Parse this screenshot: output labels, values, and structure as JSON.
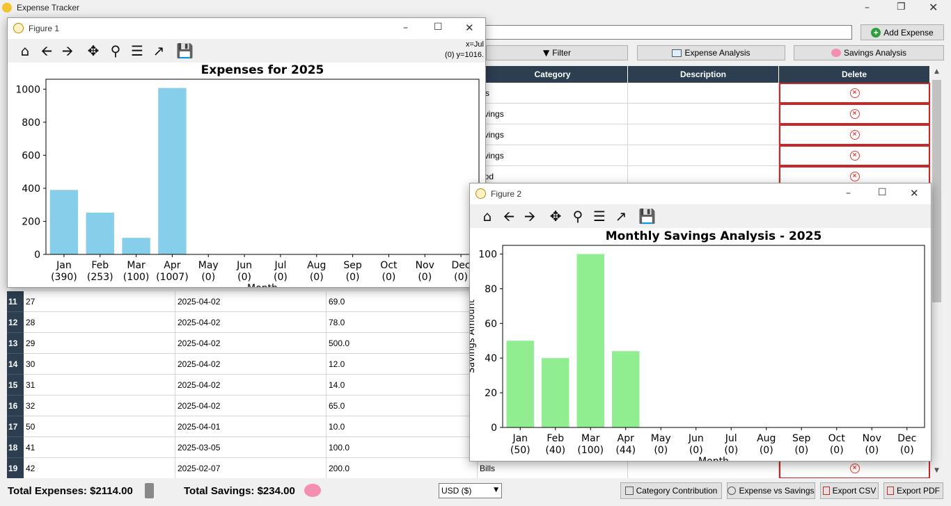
{
  "app": {
    "title": "Expense Tracker"
  },
  "toolbar": {
    "add_expense_label": "Add Expense",
    "filter_label": "Filter",
    "expense_analysis_label": "Expense Analysis",
    "savings_analysis_label": "Savings Analysis",
    "search_value": ""
  },
  "table": {
    "headers": {
      "category": "Category",
      "description": "Description",
      "delete": "Delete"
    },
    "top_rows_category": [
      "ills",
      "avings",
      "avings",
      "avings",
      "ood"
    ],
    "rows": [
      {
        "n": "11",
        "id": "27",
        "date": "2025-04-02",
        "amount": "69.0",
        "category": ""
      },
      {
        "n": "12",
        "id": "28",
        "date": "2025-04-02",
        "amount": "78.0",
        "category": ""
      },
      {
        "n": "13",
        "id": "29",
        "date": "2025-04-02",
        "amount": "500.0",
        "category": ""
      },
      {
        "n": "14",
        "id": "30",
        "date": "2025-04-02",
        "amount": "12.0",
        "category": ""
      },
      {
        "n": "15",
        "id": "31",
        "date": "2025-04-02",
        "amount": "14.0",
        "category": ""
      },
      {
        "n": "16",
        "id": "32",
        "date": "2025-04-02",
        "amount": "65.0",
        "category": ""
      },
      {
        "n": "17",
        "id": "50",
        "date": "2025-04-01",
        "amount": "10.0",
        "category": ""
      },
      {
        "n": "18",
        "id": "41",
        "date": "2025-03-05",
        "amount": "100.0",
        "category": ""
      },
      {
        "n": "19",
        "id": "42",
        "date": "2025-02-07",
        "amount": "200.0",
        "category": "Bills"
      }
    ]
  },
  "bottom": {
    "total_expenses": "Total Expenses: $2114.00",
    "total_savings": "Total Savings: $234.00",
    "currency": "USD ($)",
    "category_contribution": "Category Contribution",
    "expense_vs_savings": "Expense vs Savings",
    "export_csv": "Export CSV",
    "export_pdf": "Export PDF"
  },
  "figure1": {
    "window_title": "Figure 1",
    "coords_line1": "x=Jul",
    "coords_line2": "(0) y=1016.",
    "partial_xlabel": "Month"
  },
  "figure2": {
    "window_title": "Figure 2",
    "partial_xlabel": "Month",
    "partial_ylabel": "Savings Amount"
  },
  "chart_data": [
    {
      "type": "bar",
      "title": "Expenses for 2025",
      "categories": [
        "Jan\n(390)",
        "Feb\n(253)",
        "Mar\n(100)",
        "Apr\n(1007)",
        "May\n(0)",
        "Jun\n(0)",
        "Jul\n(0)",
        "Aug\n(0)",
        "Sep\n(0)",
        "Oct\n(0)",
        "Nov\n(0)",
        "Dec\n(0)"
      ],
      "values": [
        390,
        253,
        100,
        1007,
        0,
        0,
        0,
        0,
        0,
        0,
        0,
        0
      ],
      "xlabel": "Month",
      "ylim": [
        0,
        1060
      ],
      "yticks": [
        0,
        200,
        400,
        600,
        800,
        1000
      ],
      "color": "#87ceeb",
      "grid": false
    },
    {
      "type": "bar",
      "title": "Monthly Savings Analysis - 2025",
      "categories": [
        "Jan\n(50)",
        "Feb\n(40)",
        "Mar\n(100)",
        "Apr\n(44)",
        "May\n(0)",
        "Jun\n(0)",
        "Jul\n(0)",
        "Aug\n(0)",
        "Sep\n(0)",
        "Oct\n(0)",
        "Nov\n(0)",
        "Dec\n(0)"
      ],
      "values": [
        50,
        40,
        100,
        44,
        0,
        0,
        0,
        0,
        0,
        0,
        0,
        0
      ],
      "xlabel": "Month",
      "ylim": [
        0,
        105
      ],
      "yticks": [
        0,
        20,
        40,
        60,
        80,
        100
      ],
      "color": "#90ee90",
      "grid": false
    }
  ]
}
